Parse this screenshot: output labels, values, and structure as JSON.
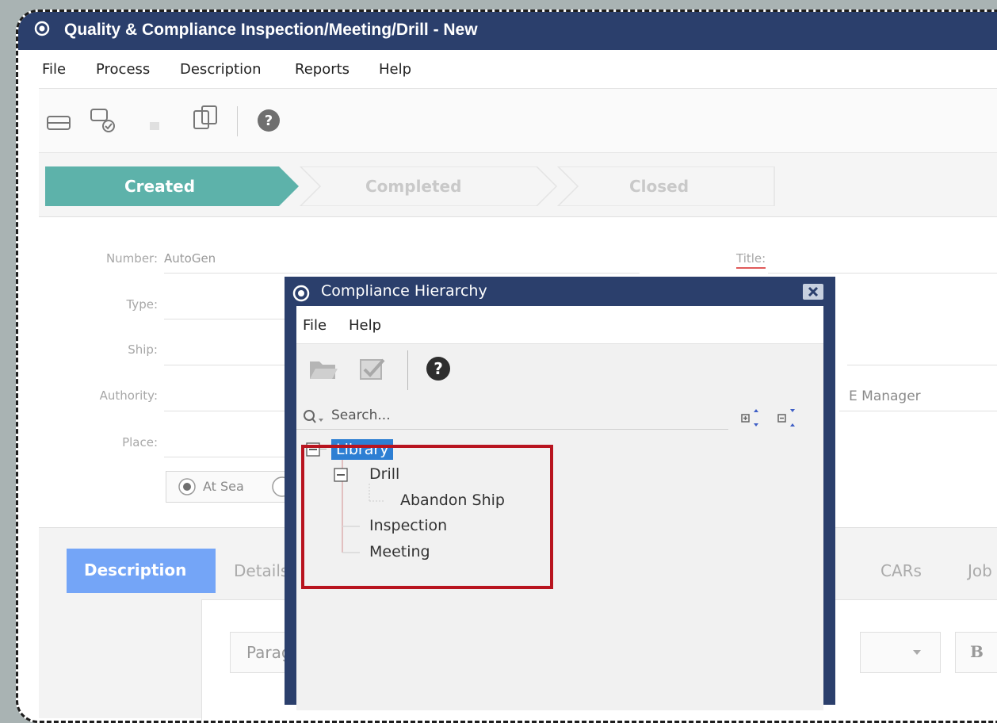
{
  "window": {
    "title": "Quality & Compliance Inspection/Meeting/Drill - New"
  },
  "menu": {
    "file": "File",
    "process": "Process",
    "description": "Description",
    "reports": "Reports",
    "help": "Help"
  },
  "toolbar": {
    "icons": [
      "save-icon",
      "save-close-icon",
      "delete-icon",
      "copy-icon",
      "help-icon"
    ]
  },
  "stepper": {
    "steps": [
      "Created",
      "Completed",
      "Closed"
    ],
    "active": "Created"
  },
  "form": {
    "number_label": "Number:",
    "number_value": "AutoGen",
    "title_label": "Title:",
    "type_label": "Type:",
    "ship_label": "Ship:",
    "authority_label": "Authority:",
    "place_label": "Place:",
    "at_sea_label": "At Sea",
    "manager_label_partial": "E Manager"
  },
  "tabs": {
    "description": "Description",
    "details": "Details",
    "cars": "CARs",
    "job": "Job S"
  },
  "editor": {
    "paragraph_partial": "Parag",
    "bold": "B"
  },
  "dialog": {
    "title": "Compliance Hierarchy",
    "close": "x",
    "menu": {
      "file": "File",
      "help": "Help"
    },
    "search_placeholder": "Search...",
    "tree": {
      "root": "Library",
      "drill": "Drill",
      "abandon_ship": "Abandon Ship",
      "inspection": "Inspection",
      "meeting": "Meeting"
    }
  },
  "colors": {
    "titlebar": "#2b3f6c",
    "step_active": "#5db2aa",
    "tab_active": "#74a5f7",
    "selection": "#2d7fd3",
    "highlight_border": "#b8141f"
  }
}
